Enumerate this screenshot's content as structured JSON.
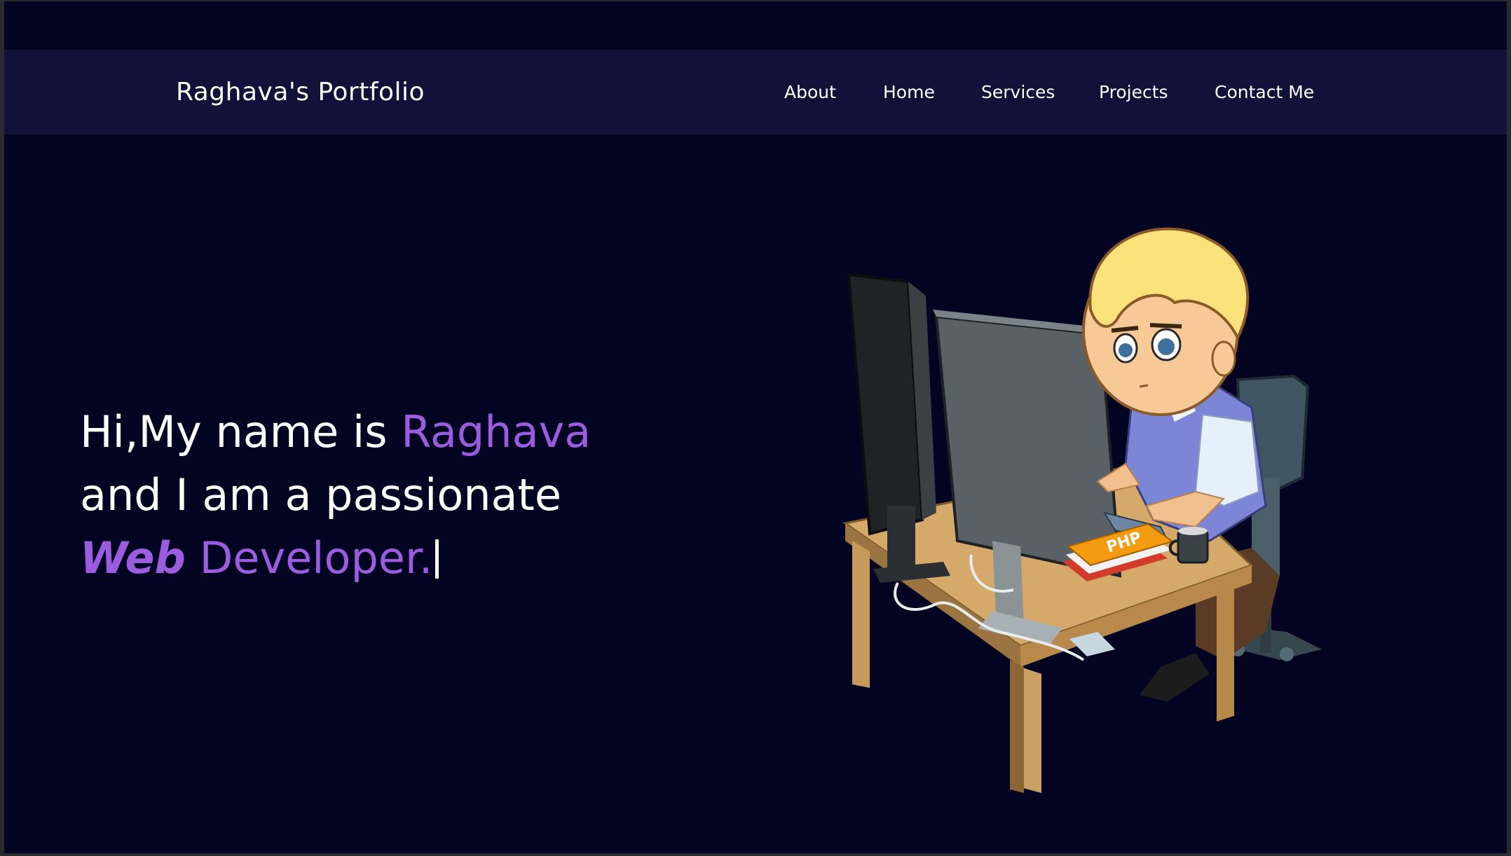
{
  "navbar": {
    "brand": "Raghava's Portfolio",
    "links": [
      "About",
      "Home",
      "Services",
      "Projects",
      "Contact Me"
    ]
  },
  "hero": {
    "line1_prefix": "Hi,My name is ",
    "line1_name": "Raghava",
    "line2": "and I am a passionate",
    "line3_bold": "Web",
    "line3_rest": " Developer."
  },
  "illustration": {
    "icon": "developer-at-desk-illustration",
    "book_label": "PHP"
  },
  "colors": {
    "background": "#030322",
    "navbar": "#111139",
    "accent": "#9b5ce0",
    "text": "#ffffff"
  }
}
